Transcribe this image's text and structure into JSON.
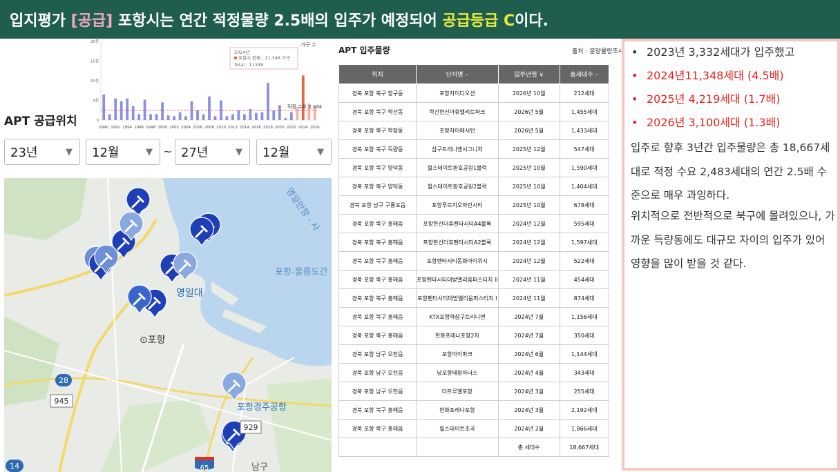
{
  "banner": {
    "part1": "입지평가 ",
    "part2": "[공급]",
    "part3": " 포항시는 연간 적정물량 2.5배의 입주가 예정되어 ",
    "part4": "공급등급 C",
    "part5": "이다."
  },
  "mini_chart": {
    "unit_label": "가구 수",
    "tooltip": {
      "year": "2024년",
      "line1": "포항시 전체 : 11,348 가구",
      "line2": "Total : 11348"
    },
    "demand_label": "적정 수요 2,464",
    "y_ticks": [
      "20천",
      "15천",
      "10천",
      "5천",
      "0"
    ],
    "x_ticks": [
      "1990",
      "1992",
      "1994",
      "1996",
      "1998",
      "2000",
      "2002",
      "2004",
      "2006",
      "2008",
      "2010",
      "2012",
      "2014",
      "2016",
      "2018",
      "2020",
      "2022",
      "2024",
      "2026"
    ]
  },
  "chart_data": {
    "type": "bar",
    "title": "",
    "xlabel": "",
    "ylabel": "가구 수",
    "ylim": [
      0,
      20000
    ],
    "categories": [
      "1990",
      "1991",
      "1992",
      "1993",
      "1994",
      "1995",
      "1996",
      "1997",
      "1998",
      "1999",
      "2000",
      "2001",
      "2002",
      "2003",
      "2004",
      "2005",
      "2006",
      "2007",
      "2008",
      "2009",
      "2010",
      "2011",
      "2012",
      "2013",
      "2014",
      "2015",
      "2016",
      "2017",
      "2018",
      "2019",
      "2020",
      "2021",
      "2022",
      "2023",
      "2024",
      "2025",
      "2026"
    ],
    "series": [
      {
        "values": [
          6500,
          1500,
          5500,
          4800,
          5500,
          3500,
          1500,
          5200,
          1500,
          1500,
          4500,
          1200,
          1000,
          2000,
          1000,
          4800,
          2500,
          1500,
          6000,
          1000,
          5000,
          1000,
          1500,
          2500,
          1500,
          2800,
          1800,
          2000,
          9500,
          2500,
          3800,
          500,
          2000,
          3300,
          11348,
          4219,
          3100
        ]
      }
    ],
    "demand_line": 2464,
    "highlight": [
      "2023",
      "2024",
      "2025",
      "2026"
    ]
  },
  "controls": {
    "title": "APT 공급위치",
    "from_year": "23년",
    "from_month": "12월",
    "tilde": "~",
    "to_year": "27년",
    "to_month": "12월"
  },
  "map": {
    "labels": {
      "yeongildae": "영일대",
      "pohang": "⊙포항",
      "airport": "포항경주공항",
      "bay": "영일만항 - 사",
      "route_sea": "포항-울릉도간",
      "nam_gu": "남구",
      "r28": "28",
      "r945": "945",
      "r929": "929",
      "r14": "14",
      "r65": "65"
    }
  },
  "table": {
    "title": "APT 입주물량",
    "source": "출처 : 분양물량조사",
    "headers": [
      "위치",
      "단지명 –",
      "입주년월 ∨",
      "총세대수 –"
    ],
    "rows": [
      [
        "경북 포항 북구 항구동",
        "포항자이디오션",
        "2026년 10월",
        "212세대"
      ],
      [
        "경북 포항 북구 학산동",
        "학산한신더휴엘리트파크",
        "2026년 5월",
        "1,455세대"
      ],
      [
        "경북 포항 북구 학잠동",
        "포항자이애서턴",
        "2026년 5월",
        "1,433세대"
      ],
      [
        "경북 포항 북구 득량동",
        "삼구트리니엔시그니처",
        "2025년 12월",
        "547세대"
      ],
      [
        "경북 포항 북구 양덕동",
        "힐스테이트환호공원1블럭",
        "2025년 10월",
        "1,590세대"
      ],
      [
        "경북 포항 북구 양덕동",
        "힐스테이트환호공원2블럭",
        "2025년 10월",
        "1,404세대"
      ],
      [
        "경북 포항 남구 구룡포읍",
        "포항푸르지오마린시티",
        "2025년 10월",
        "678세대"
      ],
      [
        "경북 포항 북구 흥해읍",
        "포항한신더휴펜타시티A4블록",
        "2024년 12월",
        "595세대"
      ],
      [
        "경북 포항 북구 흥해읍",
        "포항한신더휴펜타시티A2블록",
        "2024년 12월",
        "1,597세대"
      ],
      [
        "경북 포항 북구 흥해읍",
        "포항펜타시티동화아이위시",
        "2024년 12월",
        "522세대"
      ],
      [
        "경북 포항 북구 흥해읍",
        "포항펜타시티대방엘리움퍼스티지 II",
        "2024년 11월",
        "454세대"
      ],
      [
        "경북 포항 북구 흥해읍",
        "포항펜타시티대방엘리움퍼스티지 I",
        "2024년 11월",
        "874세대"
      ],
      [
        "경북 포항 북구 흥해읍",
        "KTX포항역삼구트리니엔",
        "2024년 7월",
        "1,156세대"
      ],
      [
        "경북 포항 북구 흥해읍",
        "한화포레나포항2차",
        "2024년 7월",
        "350세대"
      ],
      [
        "경북 포항 남구 오천읍",
        "포항아이파크",
        "2024년 6월",
        "1,144세대"
      ],
      [
        "경북 포항 남구 오천읍",
        "남포항태왕아너스",
        "2024년 4월",
        "343세대"
      ],
      [
        "경북 포항 남구 오천읍",
        "더트루엘포항",
        "2024년 3월",
        "255세대"
      ],
      [
        "경북 포항 북구 흥해읍",
        "한화포레나포항",
        "2024년 3월",
        "2,192세대"
      ],
      [
        "경북 포항 북구 흥해읍",
        "힐스테이트초곡",
        "2024년 2월",
        "1,866세대"
      ]
    ],
    "total_label": "총 세대수",
    "total_value": "18,667세대"
  },
  "notes": {
    "bullet": "•",
    "items": [
      {
        "text": "2023년 3,332세대가 입주했고",
        "color": "#333333"
      },
      {
        "text": "2024년11,348세대 (4.5배)",
        "color": "#e0231b"
      },
      {
        "text": "2025년  4,219세대 (1.7배)",
        "color": "#e0231b"
      },
      {
        "text": "2026년  3,100세대 (1.3배)",
        "color": "#e0231b"
      }
    ],
    "paragraph1": "입주로 향후 3년간 입주물량은 총 18,667세대로 적정 수요  2,483세대의 연간 2.5배 수준으로 매우 과잉하다.",
    "paragraph2": "위치적으로 전반적으로 북구에 몰려있으나, 가까운 득량동에도 대규모 자이의 입주가 있어 영향을 많이 받을 것 같다."
  }
}
